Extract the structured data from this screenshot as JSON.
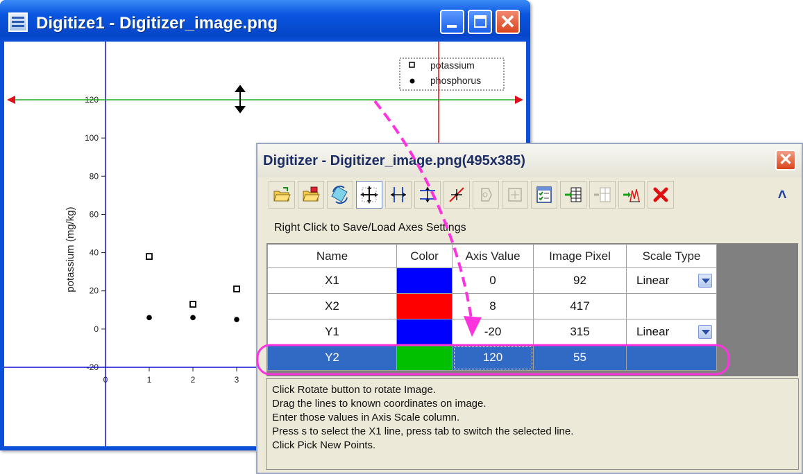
{
  "window1": {
    "title": "Digitize1 - Digitizer_image.png",
    "y_axis_title": "potassium (mg/kg)",
    "y_ticks": [
      "120",
      "100",
      "80",
      "60",
      "40",
      "20",
      "0",
      "-20"
    ],
    "x_ticks": [
      "0",
      "1",
      "2",
      "3"
    ],
    "legend": [
      "potassium",
      "phosphorus"
    ]
  },
  "chart_data": {
    "type": "scatter",
    "ylabel": "potassium (mg/kg)",
    "xlim": [
      0,
      3
    ],
    "ylim": [
      -20,
      120
    ],
    "series": [
      {
        "name": "potassium",
        "marker": "open-square",
        "x": [
          1,
          2,
          3
        ],
        "y": [
          38,
          13,
          21
        ]
      },
      {
        "name": "phosphorus",
        "marker": "filled-circle",
        "x": [
          1,
          2,
          3
        ],
        "y": [
          6,
          6,
          5
        ]
      }
    ]
  },
  "window2": {
    "title": "Digitizer - Digitizer_image.png(495x385)",
    "hint": "Right Click to Save/Load Axes Settings",
    "columns": [
      "Name",
      "Color",
      "Axis Value",
      "Image Pixel",
      "Scale Type"
    ],
    "rows": [
      {
        "name": "X1",
        "color": "#0000ff",
        "axis_value": "0",
        "image_pixel": "92",
        "scale": "Linear"
      },
      {
        "name": "X2",
        "color": "#ff0000",
        "axis_value": "8",
        "image_pixel": "417",
        "scale": ""
      },
      {
        "name": "Y1",
        "color": "#0000ff",
        "axis_value": "-20",
        "image_pixel": "315",
        "scale": "Linear"
      },
      {
        "name": "Y2",
        "color": "#00c000",
        "axis_value": "120",
        "image_pixel": "55",
        "scale": ""
      }
    ],
    "status": [
      "Click Rotate button to rotate Image.",
      "Drag the lines to known coordinates on image.",
      "Enter those values in Axis Scale column.",
      "Press s to select the X1 line, press tab to switch the selected line.",
      "Click Pick New Points."
    ]
  },
  "toolbar_icons": [
    "open-folder-icon",
    "import-folder-icon",
    "rotate-image-icon",
    "axis-lines-icon",
    "x-axis-lines-icon",
    "y-axis-lines-icon",
    "pick-points-icon",
    "disabled-tool-icon",
    "disabled-tool-icon",
    "data-table-icon",
    "go-to-worksheet-icon",
    "disabled-worksheet-icon",
    "go-to-graph-icon",
    "delete-icon"
  ],
  "colors": {
    "accent_magenta": "#ff33dd",
    "x_axis_line": "#1010d0",
    "y2_line": "#1faa1f",
    "x2_line": "#e0101a"
  }
}
